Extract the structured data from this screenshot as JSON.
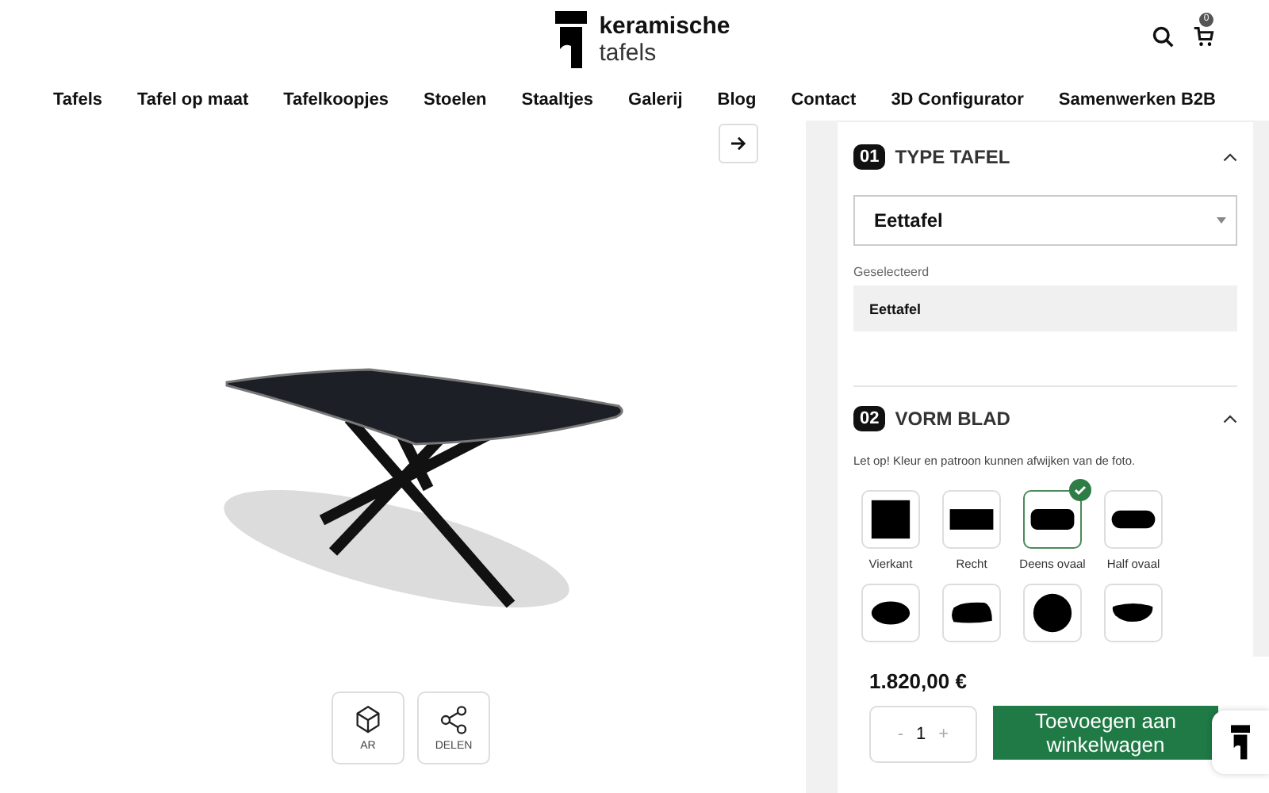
{
  "logo": {
    "line1": "keramische",
    "line2": "tafels"
  },
  "cart": {
    "count": "0"
  },
  "nav": [
    "Tafels",
    "Tafel op maat",
    "Tafelkoopjes",
    "Stoelen",
    "Staaltjes",
    "Galerij",
    "Blog",
    "Contact",
    "3D Configurator",
    "Samenwerken B2B"
  ],
  "viewer": {
    "actions": [
      {
        "kind": "ar",
        "label": "AR"
      },
      {
        "kind": "share",
        "label": "DELEN"
      }
    ]
  },
  "sections": [
    {
      "number": "01",
      "title": "TYPE TAFEL",
      "expanded": true,
      "select": {
        "value": "Eettafel"
      },
      "selected_label": "Geselecteerd",
      "selected_value": "Eettafel"
    },
    {
      "number": "02",
      "title": "VORM BLAD",
      "expanded": true,
      "note": "Let op! Kleur en patroon kunnen afwijken van de foto.",
      "shapes": [
        {
          "kind": "square",
          "label": "Vierkant",
          "selected": false
        },
        {
          "kind": "rect",
          "label": "Recht",
          "selected": false
        },
        {
          "kind": "danish",
          "label": "Deens ovaal",
          "selected": true
        },
        {
          "kind": "half",
          "label": "Half ovaal",
          "selected": false
        },
        {
          "kind": "oval",
          "selected": false
        },
        {
          "kind": "organic",
          "selected": false
        },
        {
          "kind": "round",
          "selected": false
        },
        {
          "kind": "drop",
          "selected": false
        }
      ]
    }
  ],
  "price": "1.820,00 €",
  "quantity": {
    "minus": "-",
    "value": "1",
    "plus": "+"
  },
  "add_button": "Toevoegen aan winkelwagen"
}
